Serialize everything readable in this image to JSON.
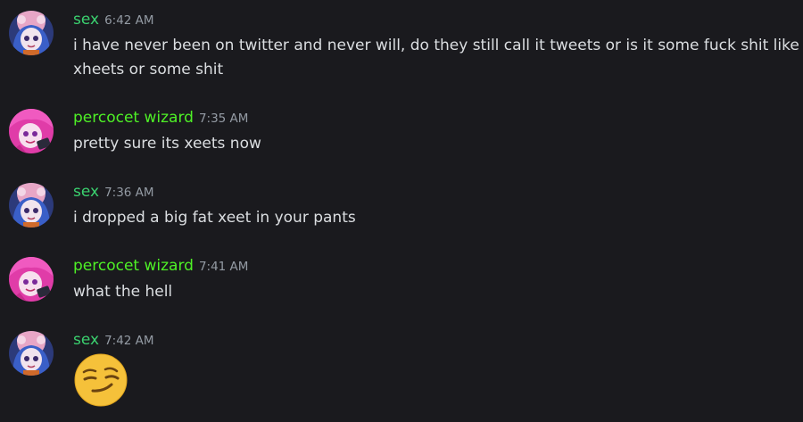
{
  "colors": {
    "background": "#1a1a1e",
    "username_sex": "#3bd16f",
    "username_percocet": "#4ef026",
    "timestamp": "#949ba4",
    "text": "#dbdee1"
  },
  "messages": [
    {
      "username": "sex",
      "timestamp": "6:42 AM",
      "avatar_icon": "avatar-blue-hair-icon",
      "text": "i have never been on twitter and never will, do they still call it tweets or is it some fuck shit like xheets or some shit"
    },
    {
      "username": "percocet wizard",
      "timestamp": "7:35 AM",
      "avatar_icon": "avatar-pink-hair-icon",
      "text": "pretty sure its xeets now"
    },
    {
      "username": "sex",
      "timestamp": "7:36 AM",
      "avatar_icon": "avatar-blue-hair-icon",
      "text": "i dropped a big fat xeet in your pants"
    },
    {
      "username": "percocet wizard",
      "timestamp": "7:41 AM",
      "avatar_icon": "avatar-pink-hair-icon",
      "text": "what the hell"
    },
    {
      "username": "sex",
      "timestamp": "7:42 AM",
      "avatar_icon": "avatar-blue-hair-icon",
      "emoji": "smirking-face-emoji"
    }
  ]
}
